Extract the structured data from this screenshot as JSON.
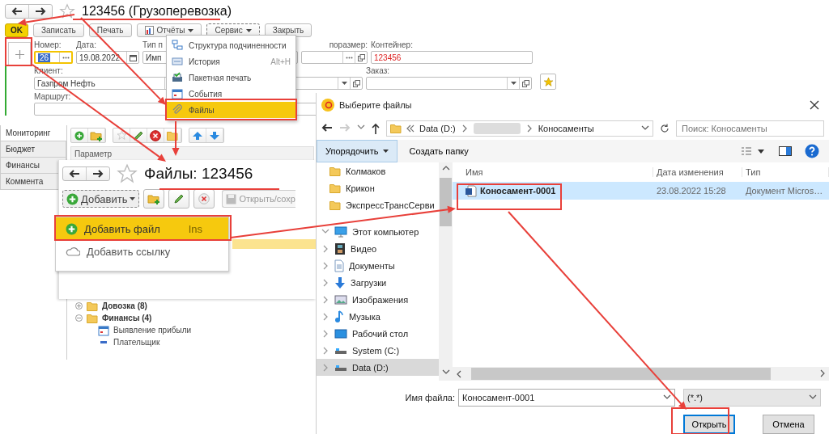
{
  "document_form": {
    "title": "123456 (Грузоперевозка)",
    "buttons": [
      {
        "label": "OK",
        "kind": "default"
      },
      {
        "label": "Записать",
        "kind": "plain"
      },
      {
        "label": "Печать",
        "kind": "plain"
      },
      {
        "label": "Отчёты",
        "kind": "reports"
      },
      {
        "label": "Сервис",
        "kind": "menu"
      },
      {
        "label": "Закрыть",
        "kind": "plain"
      }
    ],
    "fields": [
      {
        "label": "Номер:",
        "value": "26",
        "kind": "choice",
        "focused": true
      },
      {
        "label": "Дата:",
        "value": "19.08.2022",
        "kind": "date"
      },
      {
        "label": "Тип п",
        "value": "Имп",
        "kind": "text"
      },
      {
        "label": "поразмер:",
        "kind": "choice"
      },
      {
        "label": "Контейнер:",
        "value": "123456",
        "kind": "text",
        "highlighted": true
      },
      {
        "label": "Клиент:",
        "value": "Газпром Нефть",
        "kind": "select"
      },
      {
        "kind": "select"
      },
      {
        "label": "Заказ:",
        "kind": "select"
      },
      {
        "label": "Маршрут:",
        "kind": "text"
      }
    ]
  },
  "service_menu": [
    {
      "label": "Структура подчиненности",
      "kind": "structure",
      "selected": false
    },
    {
      "label": "История",
      "shortcut": "Alt+H",
      "kind": "history",
      "selected": false
    },
    {
      "label": "Пакетная печать",
      "kind": "print",
      "selected": false
    },
    {
      "label": "События",
      "kind": "events",
      "selected": false
    },
    {
      "label": "Файлы",
      "kind": "files",
      "selected": true
    }
  ],
  "side_panel": {
    "tabs": [
      {
        "label": "Мониторинг",
        "selected": true
      },
      {
        "label": "Бюджет",
        "selected": false
      },
      {
        "label": "Финансы",
        "selected": false
      },
      {
        "label": "Коммента",
        "selected": false
      }
    ],
    "column": "Параметр",
    "tree": [
      {
        "label": "Довозка (8)",
        "expanded": false
      },
      {
        "label": "Финансы (4)",
        "expanded": true,
        "children": [
          {
            "label": "Выявление прибыли",
            "kind": "calendar"
          },
          {
            "label": "Плательщик",
            "kind": "dash"
          }
        ]
      }
    ]
  },
  "files_window": {
    "title": "Файлы: 123456",
    "add_button": "Добавить",
    "open_button": "Открыть/сохр",
    "menu": [
      {
        "label": "Добавить файл",
        "shortcut": "Ins",
        "kind": "add",
        "selected": true
      },
      {
        "label": "Добавить ссылку",
        "kind": "link",
        "selected": false
      }
    ]
  },
  "file_dialog": {
    "title": "Выберите файлы",
    "path": [
      "Data (D:)",
      "Коносаменты"
    ],
    "search": {
      "placeholder": "Поиск: Коносаменты"
    },
    "toolbar": [
      "Упорядочить",
      "Создать папку"
    ],
    "nav": [
      {
        "label": "Колмаков",
        "kind": "folder",
        "selected": false
      },
      {
        "label": "Крикон",
        "kind": "folder",
        "selected": false
      },
      {
        "label": "ЭкспрессТрансСерви",
        "kind": "folder",
        "selected": false
      },
      {
        "label": "Этот компьютер",
        "kind": "computer",
        "expanded": true,
        "selected": false,
        "children": [
          {
            "label": "Видео",
            "kind": "video",
            "expanded": false,
            "selected": false
          },
          {
            "label": "Документы",
            "kind": "documents",
            "expanded": false,
            "selected": false
          },
          {
            "label": "Загрузки",
            "kind": "downloads",
            "expanded": false,
            "selected": false
          },
          {
            "label": "Изображения",
            "kind": "pictures",
            "expanded": false,
            "selected": false
          },
          {
            "label": "Музыка",
            "kind": "music",
            "expanded": false,
            "selected": false
          },
          {
            "label": "Рабочий стол",
            "kind": "desktop",
            "expanded": false,
            "selected": false
          },
          {
            "label": "System (C:)",
            "kind": "drive",
            "expanded": false,
            "selected": false
          },
          {
            "label": "Data (D:)",
            "kind": "drive",
            "expanded": false,
            "selected": true
          }
        ]
      }
    ],
    "columns": [
      "Имя",
      "Дата изменения",
      "Тип"
    ],
    "files": [
      {
        "name": "Коносамент-0001",
        "date": "23.08.2022 15:28",
        "type": "Документ Micros…",
        "selected": true
      }
    ],
    "filename_label": "Имя файла:",
    "filename": "Коносамент-0001",
    "filter": "(*.*)",
    "buttons": [
      {
        "label": "Открыть",
        "kind": "default"
      },
      {
        "label": "Отмена",
        "kind": "plain"
      }
    ]
  }
}
